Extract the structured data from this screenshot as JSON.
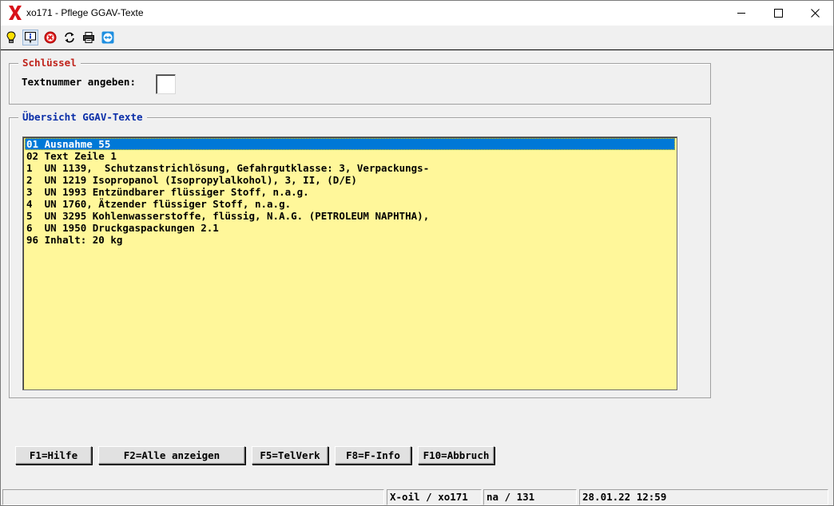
{
  "window": {
    "title": "xo171 - Pflege GGAV-Texte"
  },
  "toolbar": {
    "icons": [
      "lightbulb-icon",
      "info-icon",
      "cancel-icon",
      "refresh-icon",
      "printer-icon",
      "teamviewer-icon"
    ]
  },
  "schluessel": {
    "legend": "Schlüssel",
    "legend_color": "#c0241c",
    "textnummer_label": "Textnummer angeben:",
    "textnummer_value": ""
  },
  "uebersicht": {
    "legend": "Übersicht GGAV-Texte",
    "legend_color": "#0a2ea8",
    "list_bg_color": "#fff79a",
    "items": [
      "01 Ausnahme 55",
      "02 Text Zeile 1",
      "1  UN 1139,  Schutzanstrichlösung, Gefahrgutklasse: 3, Verpackungs-",
      "2  UN 1219 Isopropanol (Isopropylalkohol), 3, II, (D/E)",
      "3  UN 1993 Entzündbarer flüssiger Stoff, n.a.g.",
      "4  UN 1760, Ätzender flüssiger Stoff, n.a.g.",
      "5  UN 3295 Kohlenwasserstoffe, flüssig, N.A.G. (PETROLEUM NAPHTHA),",
      "6  UN 1950 Druckgaspackungen 2.1",
      "96 Inhalt: 20 kg"
    ],
    "selected_index": 0
  },
  "buttons": {
    "f1": "F1=Hilfe",
    "f2": "F2=Alle anzeigen",
    "f5": "F5=TelVerk",
    "f8": "F8=F-Info",
    "f10": "F10=Abbruch"
  },
  "status": {
    "cell1": "",
    "cell2": "X-oil / xo171",
    "cell3": "na / 131",
    "cell4": "28.01.22 12:59"
  }
}
